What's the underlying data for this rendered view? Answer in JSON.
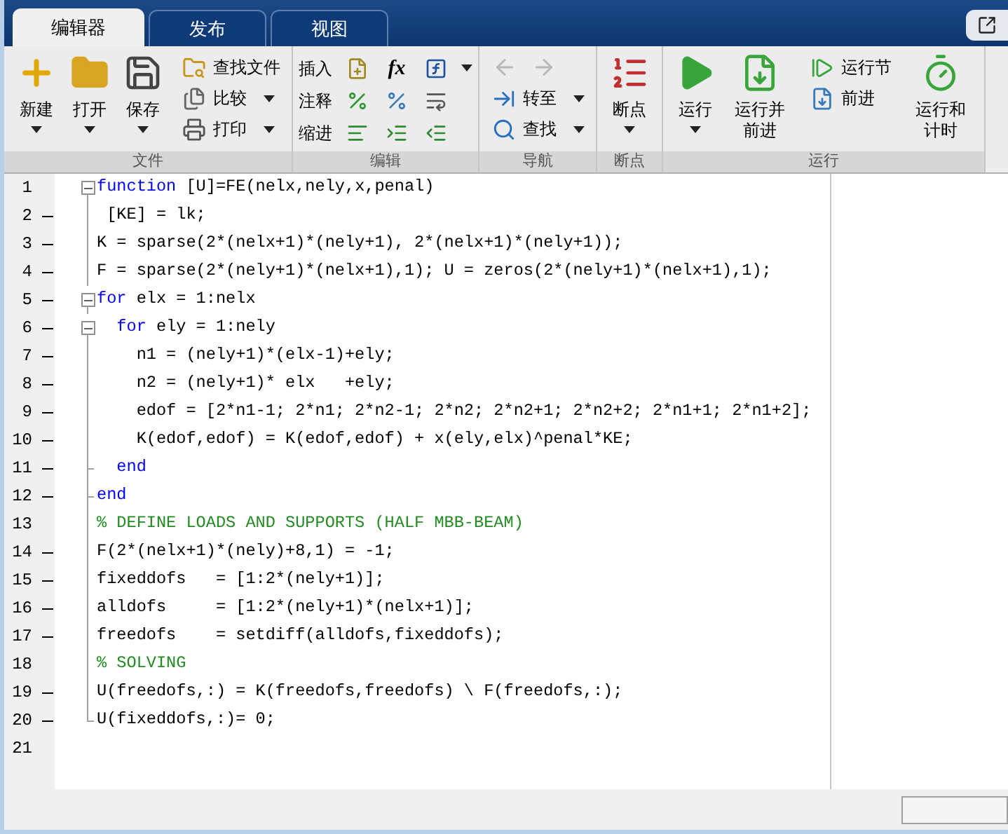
{
  "tabs": [
    {
      "label": "编辑器",
      "selected": true
    },
    {
      "label": "发布",
      "selected": false
    },
    {
      "label": "视图",
      "selected": false
    }
  ],
  "toolbar": {
    "sections": [
      {
        "title": "文件",
        "groups": [
          {
            "kind": "large",
            "items": [
              {
                "kind": "new",
                "label": "新建",
                "dropdown": true
              },
              {
                "kind": "open",
                "label": "打开",
                "dropdown": true
              },
              {
                "kind": "save",
                "label": "保存",
                "dropdown": true
              }
            ]
          },
          {
            "kind": "small",
            "items": [
              {
                "kind": "find-files",
                "label": "查找文件",
                "dropdown": false
              },
              {
                "kind": "compare",
                "label": "比较",
                "dropdown": true
              },
              {
                "kind": "print",
                "label": "打印",
                "dropdown": true
              }
            ]
          }
        ]
      },
      {
        "title": "编辑",
        "groups": [
          {
            "kind": "rows",
            "items": [
              {
                "label": "插入",
                "dropdown": true,
                "buttons": [
                  {
                    "kind": "insert"
                  },
                  {
                    "kind": "fx",
                    "text": "fx"
                  },
                  {
                    "kind": "function"
                  }
                ]
              },
              {
                "label": "注释",
                "dropdown": false,
                "buttons": [
                  {
                    "kind": "comment"
                  },
                  {
                    "kind": "uncomment"
                  },
                  {
                    "kind": "wrap"
                  }
                ]
              },
              {
                "label": "缩进",
                "dropdown": false,
                "buttons": [
                  {
                    "kind": "smart-indent"
                  },
                  {
                    "kind": "indent"
                  },
                  {
                    "kind": "outdent"
                  }
                ]
              }
            ]
          }
        ]
      },
      {
        "title": "导航",
        "groups": [
          {
            "kind": "small",
            "items": [
              {
                "kind": "history",
                "buttons": [
                  {
                    "kind": "back",
                    "disabled": true
                  },
                  {
                    "kind": "forward",
                    "disabled": true
                  }
                ]
              },
              {
                "kind": "goto",
                "label": "转至",
                "dropdown": true
              },
              {
                "kind": "find",
                "label": "查找",
                "dropdown": true
              }
            ]
          }
        ]
      },
      {
        "title": "断点",
        "groups": [
          {
            "kind": "large",
            "items": [
              {
                "kind": "breakpoints",
                "label": "断点",
                "dropdown": true
              }
            ]
          }
        ]
      },
      {
        "title": "运行",
        "groups": [
          {
            "kind": "large",
            "items": [
              {
                "kind": "run",
                "label": "运行",
                "dropdown": true
              },
              {
                "kind": "run-advance",
                "label": "运行并前进",
                "dropdown": false
              }
            ]
          },
          {
            "kind": "small",
            "items": [
              {
                "kind": "run-section",
                "label": "运行节",
                "dropdown": false
              },
              {
                "kind": "advance",
                "label": "前进",
                "dropdown": false
              }
            ]
          },
          {
            "kind": "large",
            "items": [
              {
                "kind": "run-time",
                "label": "运行和计时",
                "dropdown": false
              }
            ]
          }
        ]
      }
    ]
  },
  "editor": {
    "lines": [
      {
        "number": "1",
        "executable": false,
        "kind": "start",
        "segments": [
          {
            "kind": "keyword",
            "text": "function"
          },
          {
            "kind": "plain",
            "text": " [U]=FE(nelx,nely,x,penal)"
          }
        ]
      },
      {
        "number": "2",
        "executable": true,
        "kind": "inside",
        "segments": [
          {
            "kind": "plain",
            "text": " [KE] = lk;"
          }
        ]
      },
      {
        "number": "3",
        "executable": true,
        "kind": "inside",
        "segments": [
          {
            "kind": "plain",
            "text": "K = sparse(2*(nelx+1)*(nely+1), 2*(nelx+1)*(nely+1));"
          }
        ]
      },
      {
        "number": "4",
        "executable": true,
        "kind": "inside",
        "segments": [
          {
            "kind": "plain",
            "text": "F = sparse(2*(nely+1)*(nelx+1),1); U = zeros(2*(nely+1)*(nelx+1),1);"
          }
        ]
      },
      {
        "number": "5",
        "executable": true,
        "kind": "start",
        "segments": [
          {
            "kind": "keyword",
            "text": "for"
          },
          {
            "kind": "plain",
            "text": " elx = 1:nelx"
          }
        ]
      },
      {
        "number": "6",
        "executable": true,
        "kind": "start",
        "segments": [
          {
            "kind": "keyword",
            "text": "  for"
          },
          {
            "kind": "plain",
            "text": " ely = 1:nely"
          }
        ]
      },
      {
        "number": "7",
        "executable": true,
        "kind": "inside",
        "segments": [
          {
            "kind": "plain",
            "text": "    n1 = (nely+1)*(elx-1)+ely;"
          }
        ]
      },
      {
        "number": "8",
        "executable": true,
        "kind": "inside",
        "segments": [
          {
            "kind": "plain",
            "text": "    n2 = (nely+1)* elx   +ely;"
          }
        ]
      },
      {
        "number": "9",
        "executable": true,
        "kind": "inside",
        "segments": [
          {
            "kind": "plain",
            "text": "    edof = [2*n1-1; 2*n1; 2*n2-1; 2*n2; 2*n2+1; 2*n2+2; 2*n1+1; 2*n1+2];"
          }
        ]
      },
      {
        "number": "10",
        "executable": true,
        "kind": "inside",
        "segments": [
          {
            "kind": "plain",
            "text": "    K(edof,edof) = K(edof,edof) + x(ely,elx)^penal*KE;"
          }
        ]
      },
      {
        "number": "11",
        "executable": true,
        "kind": "end",
        "segments": [
          {
            "kind": "keyword",
            "text": "  end"
          }
        ]
      },
      {
        "number": "12",
        "executable": true,
        "kind": "end",
        "segments": [
          {
            "kind": "keyword",
            "text": "end"
          }
        ]
      },
      {
        "number": "13",
        "executable": false,
        "kind": "inside",
        "segments": [
          {
            "kind": "comment",
            "text": "% DEFINE LOADS AND SUPPORTS (HALF MBB-BEAM)"
          }
        ]
      },
      {
        "number": "14",
        "executable": true,
        "kind": "inside",
        "segments": [
          {
            "kind": "plain",
            "text": "F(2*(nelx+1)*(nely)+8,1) = -1;"
          }
        ]
      },
      {
        "number": "15",
        "executable": true,
        "kind": "inside",
        "segments": [
          {
            "kind": "plain",
            "text": "fixeddofs   = [1:2*(nely+1)];"
          }
        ]
      },
      {
        "number": "16",
        "executable": true,
        "kind": "inside",
        "segments": [
          {
            "kind": "plain",
            "text": "alldofs     = [1:2*(nely+1)*(nelx+1)];"
          }
        ]
      },
      {
        "number": "17",
        "executable": true,
        "kind": "inside",
        "segments": [
          {
            "kind": "plain",
            "text": "freedofs    = setdiff(alldofs,fixeddofs);"
          }
        ]
      },
      {
        "number": "18",
        "executable": false,
        "kind": "inside",
        "segments": [
          {
            "kind": "comment",
            "text": "% SOLVING"
          }
        ]
      },
      {
        "number": "19",
        "executable": true,
        "kind": "inside",
        "segments": [
          {
            "kind": "plain",
            "text": "U(freedofs,:) = K(freedofs,freedofs) \\ F(freedofs,:);"
          }
        ]
      },
      {
        "number": "20",
        "executable": true,
        "kind": "last",
        "segments": [
          {
            "kind": "plain",
            "text": "U(fixeddofs,:)= 0;"
          }
        ]
      },
      {
        "number": "21",
        "executable": false,
        "kind": "none"
      }
    ]
  }
}
